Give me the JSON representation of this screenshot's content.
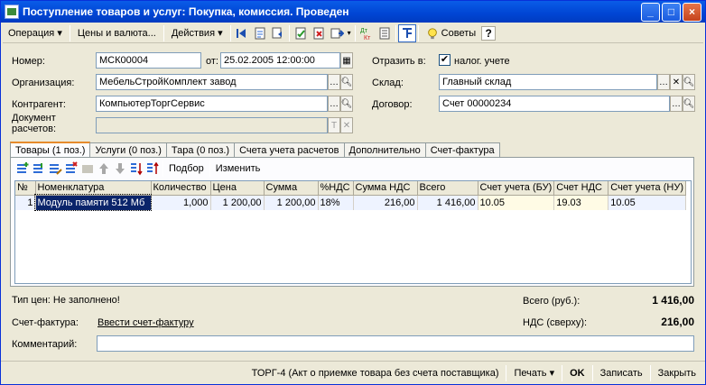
{
  "window": {
    "title": "Поступление товаров и услуг: Покупка, комиссия. Проведен",
    "minimize": "_",
    "maximize": "□",
    "close": "×"
  },
  "toolbar": {
    "operation": "Операция",
    "prices": "Цены и валюта...",
    "actions": "Действия",
    "advice": "Советы",
    "help": "?"
  },
  "form": {
    "number_label": "Номер:",
    "number": "МСК00004",
    "from_label": "от:",
    "date": "25.02.2005 12:00:00",
    "reflect_label": "Отразить в:",
    "tax_label": "налог. учете",
    "tax_checked": "✔",
    "org_label": "Организация:",
    "org": "МебельСтройКомплект завод",
    "warehouse_label": "Склад:",
    "warehouse": "Главный склад",
    "contractor_label": "Контрагент:",
    "contractor": "КомпьютерТоргСервис",
    "contract_label": "Договор:",
    "contract": "Счет 00000234",
    "settlement_label_1": "Документ",
    "settlement_label_2": "расчетов:",
    "settlement": ""
  },
  "tabs": [
    {
      "label": "Товары (1 поз.)"
    },
    {
      "label": "Услуги (0 поз.)"
    },
    {
      "label": "Тара (0 поз.)"
    },
    {
      "label": "Счета учета расчетов"
    },
    {
      "label": "Дополнительно"
    },
    {
      "label": "Счет-фактура"
    }
  ],
  "panel_toolbar": {
    "select": "Подбор",
    "change": "Изменить"
  },
  "table": {
    "headers": [
      "№",
      "Номенклатура",
      "Количество",
      "Цена",
      "Сумма",
      "%НДС",
      "Сумма НДС",
      "Всего",
      "Счет учета (БУ)",
      "Счет НДС",
      "Счет учета (НУ)"
    ],
    "rows": [
      [
        "1",
        "Модуль памяти 512 Мб",
        "1,000",
        "1 200,00",
        "1 200,00",
        "18%",
        "216,00",
        "1 416,00",
        "10.05",
        "19.03",
        "10.05"
      ]
    ]
  },
  "footer": {
    "price_type": "Тип цен: Не заполнено!",
    "total_label": "Всего (руб.):",
    "total": "1 416,00",
    "invoice_label": "Счет-фактура:",
    "invoice_link": "Ввести счет-фактуру",
    "vat_label": "НДС (сверху):",
    "vat": "216,00",
    "comment_label": "Комментарий:",
    "comment": ""
  },
  "statusbar": {
    "torg": "ТОРГ-4 (Акт о приемке товара без счета поставщика)",
    "print": "Печать",
    "ok": "OK",
    "save": "Записать",
    "close": "Закрыть"
  }
}
